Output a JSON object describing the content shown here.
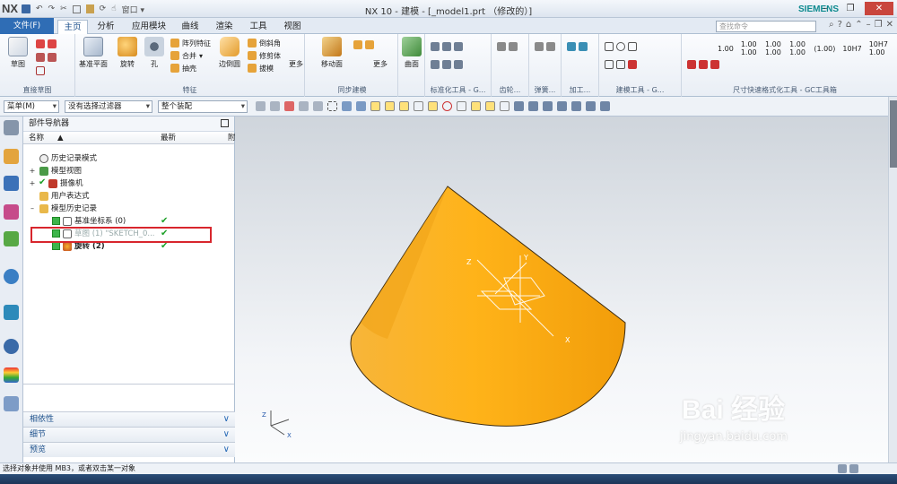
{
  "app": {
    "logo": "NX",
    "title": "NX 10 - 建模 - [_model1.prt （修改的）]",
    "brand": "SIEMENS",
    "window_menu": "窗口"
  },
  "ribbon_tabs": [
    {
      "label": "文件(F)"
    },
    {
      "label": "主页"
    },
    {
      "label": "分析"
    },
    {
      "label": "应用模块"
    },
    {
      "label": "曲线"
    },
    {
      "label": "渲染"
    },
    {
      "label": "工具"
    },
    {
      "label": "视图"
    }
  ],
  "search": {
    "placeholder": "查找命令"
  },
  "ribbon": {
    "sketch": "草图",
    "group_direct_sketch": "直接草图",
    "datum_plane": "基准平面",
    "revolve": "旋转",
    "hole": "孔",
    "pattern_feature": "阵列特征",
    "combine": "合并",
    "shell": "抽壳",
    "edge_blend": "边倒圆",
    "chamfer": "倒斜角",
    "trim_body": "修剪体",
    "draft": "拔模",
    "more": "更多",
    "group_feature": "特征",
    "move_face": "移动面",
    "group_sync": "同步建模",
    "more2": "更多",
    "surface": "曲面",
    "group_std": "标准化工具 - G...",
    "group_gear": "齿轮...",
    "group_spring": "弹簧...",
    "group_machining": "加工...",
    "group_build": "建模工具 - G...",
    "group_dim": "尺寸快速格式化工具 - GC工具箱",
    "dim_vals": [
      "1.00",
      "1.00\n1.00",
      "1.00\n1.00",
      "1.00\n1.00",
      "(1.00)",
      "10H7",
      "10H7\n1.00"
    ]
  },
  "toolbar": {
    "menu": "菜单(M)",
    "filter": "没有选择过滤器",
    "assembly": "整个装配"
  },
  "navigator": {
    "title": "部件导航器",
    "col_name": "名称",
    "col_latest": "最新",
    "col_extra": "附",
    "rows": [
      {
        "label": "历史记录模式"
      },
      {
        "label": "模型视图"
      },
      {
        "label": "摄像机"
      },
      {
        "label": "用户表达式"
      },
      {
        "label": "模型历史记录"
      },
      {
        "label": "基准坐标系 (0)"
      },
      {
        "label": "草图 (1) \"SKETCH_0..."
      },
      {
        "label": "旋转 (2)"
      }
    ],
    "panels": [
      {
        "label": "相依性"
      },
      {
        "label": "细节"
      },
      {
        "label": "预览"
      }
    ]
  },
  "viewport": {
    "axis_x": "X",
    "axis_y": "Y",
    "axis_z": "Z",
    "cone_color": "#f5a623"
  },
  "status": {
    "text": "选择对象并使用 MB3，或者双击某一对象"
  },
  "watermark": {
    "brand": "Bai 经验",
    "url": "jingyan.baidu.com"
  }
}
